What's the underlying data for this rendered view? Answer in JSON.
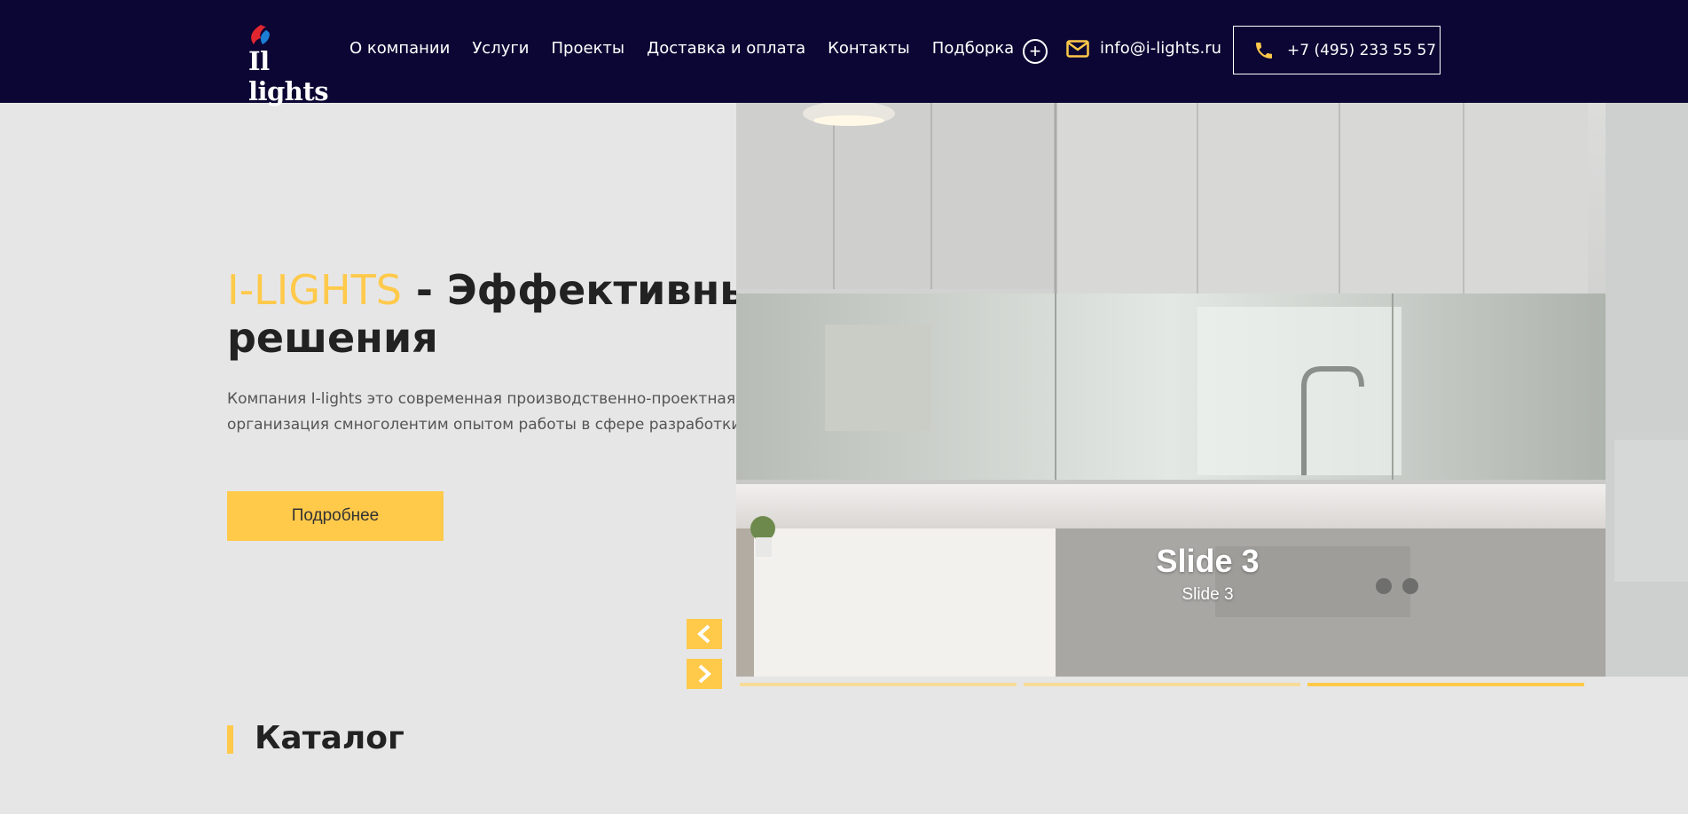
{
  "header": {
    "logo_text": "lights",
    "nav": [
      "О компании",
      "Услуги",
      "Проекты",
      "Доставка и оплата",
      "Контакты",
      "Подборка"
    ],
    "email": "info@i-lights.ru",
    "phone": "+7 (495) 233 55 57"
  },
  "hero": {
    "title_accent": "I-LIGHTS",
    "title_rest": " - Эффективные",
    "title_line2": "решения",
    "desc_line1": "Компания I-lights это современная производственно-проектная",
    "desc_line2": "организация смноголентим опытом работы в сфере разработки",
    "button": "Подробнее"
  },
  "slider": {
    "title": "Slide 3",
    "subtitle": "Slide 3",
    "active_index": 2,
    "count": 3
  },
  "catalog": {
    "title": "Каталог"
  },
  "colors": {
    "header_bg": "#0c0634",
    "accent": "#ffc94a",
    "page_bg": "#e6e6e6"
  }
}
